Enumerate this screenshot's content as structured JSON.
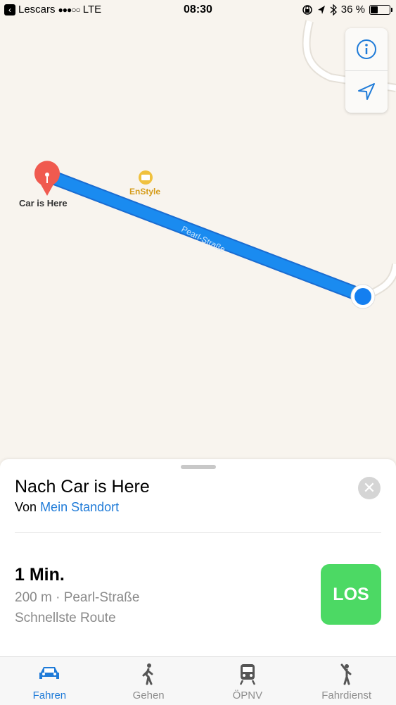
{
  "status_bar": {
    "back_app": "Lescars",
    "carrier": "LTE",
    "signal_dots": "●●●○○",
    "time": "08:30",
    "battery": "36 %",
    "battery_level": 0.36
  },
  "map": {
    "pin_label": "Car is Here",
    "poi_label": "EnStyle",
    "street_label": "Pearl-Straße",
    "colors": {
      "route": "#1a8bf0",
      "pin": "#f05a4f",
      "user_dot": "#147ff0",
      "poi": "#d59c1a"
    }
  },
  "controls": {
    "info_icon": "info-icon",
    "location_icon": "location-arrow-icon"
  },
  "sheet": {
    "title": "Nach Car is Here",
    "from_prefix": "Von",
    "from_link": "Mein Standort",
    "close_icon": "close-icon",
    "eta": "1 Min.",
    "distance": "200 m · Pearl-Straße",
    "route_type": "Schnellste Route",
    "go_label": "LOS",
    "go_color": "#4cd964"
  },
  "tabs": [
    {
      "label": "Fahren",
      "icon": "car-icon",
      "active": true
    },
    {
      "label": "Gehen",
      "icon": "walk-icon",
      "active": false
    },
    {
      "label": "ÖPNV",
      "icon": "train-icon",
      "active": false
    },
    {
      "label": "Fahrdienst",
      "icon": "hail-icon",
      "active": false
    }
  ]
}
